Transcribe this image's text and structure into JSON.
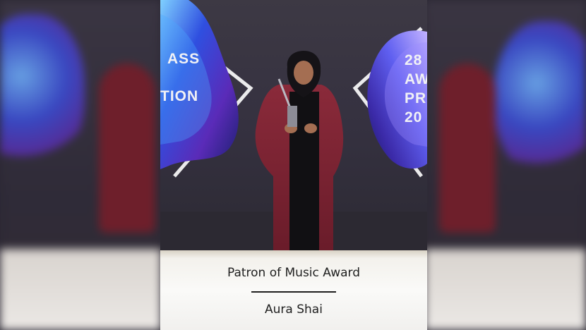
{
  "caption": {
    "award": "Patron of Music Award",
    "recipient": "Aura Shai"
  },
  "backdrop": {
    "left_line_1": "ASS",
    "left_line_2": "TION",
    "right_lines": "28\nAW\nPR\n20"
  },
  "colors": {
    "robe": "#7a2331",
    "backdrop": "#353140",
    "accent_blue": "#3d5cf0",
    "accent_purple": "#8a3fd1"
  }
}
